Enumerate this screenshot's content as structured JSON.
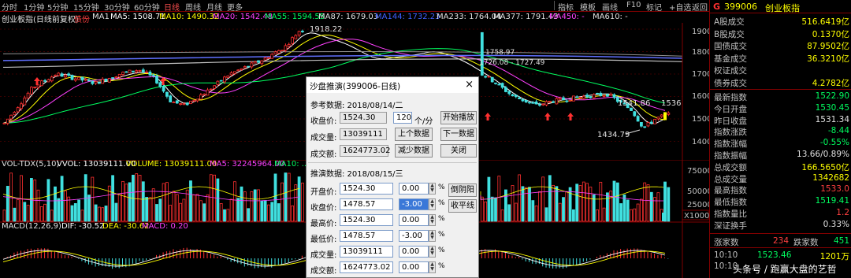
{
  "toolbar": {
    "periods": [
      "分时",
      "1分钟",
      "5分钟",
      "15分钟",
      "30分钟",
      "60分钟",
      "日线",
      "周线",
      "月线",
      "更多"
    ],
    "active_period": "日线",
    "tools": [
      "指标",
      "模板",
      "画线",
      "F10",
      "标记",
      "+自选",
      "返回"
    ]
  },
  "main_info": {
    "title": "创业板指(日线前复权)",
    "badge": "债份",
    "ma1": "MA1",
    "ma5": "MA5: 1508.71",
    "ma10": "MA10: 1490.32",
    "ma20": "MA20: 1542.48",
    "ma55": "MA55: 1594.55",
    "ma87": "MA87: 1679.03",
    "ma144": "MA144: 1732.23",
    "ma233": "MA233: 1764.04",
    "ma377": "MA377: 1791.43",
    "ma450": "MA450: -",
    "ma610": "MA610: -"
  },
  "main_chart": {
    "y_ticks": [
      "1900",
      "1800",
      "1700",
      "1600",
      "1500",
      "1400"
    ],
    "annotations": {
      "high": "1918.22",
      "label_mid1": "1758.97",
      "label_mid2": "1726.08 - 1727.49",
      "label_right": "1541.86",
      "label_right2": "1536",
      "low": "1434.79"
    }
  },
  "volume_info": {
    "title": "VOL-TDX(5,10)",
    "vvol": "VVOL: 13039111.00",
    "volume": "VOLUME: 13039111.00",
    "ma5": "MA5: 32245964.00",
    "ma10": "MA10: ..."
  },
  "volume_chart": {
    "y_ticks": [
      "75000",
      "50000",
      "25000"
    ],
    "unit": "X1000"
  },
  "macd_info": {
    "title": "MACD(12,26,9)",
    "dif": "DIF: -30.52",
    "dea": "DEA: -30.62",
    "macd": "MACD: 0.20"
  },
  "quote": {
    "g": "G",
    "code": "399006",
    "name": "创业板指",
    "rows1": [
      {
        "label": "A股成交",
        "value": "516.6419亿",
        "color": "#ffff00"
      },
      {
        "label": "B股成交",
        "value": "0.1370亿",
        "color": "#ffff00"
      },
      {
        "label": "国债成交",
        "value": "87.9502亿",
        "color": "#ffff00"
      },
      {
        "label": "基金成交",
        "value": "36.3210亿",
        "color": "#ffff00"
      },
      {
        "label": "权证成交",
        "value": "",
        "color": "#ffff00"
      },
      {
        "label": "债券成交",
        "value": "4.2782亿",
        "color": "#ffff00"
      }
    ],
    "rows2": [
      {
        "label": "最新指数",
        "value": "1522.90",
        "color": "#00ff60"
      },
      {
        "label": "今日开盘",
        "value": "1530.45",
        "color": "#00ff60"
      },
      {
        "label": "昨日收盘",
        "value": "1531.34",
        "color": "#e0e0e0"
      },
      {
        "label": "指数涨跌",
        "value": "-8.44",
        "color": "#00ff60"
      },
      {
        "label": "指数涨幅",
        "value": "-0.55%",
        "color": "#00ff60"
      },
      {
        "label": "指数振幅",
        "value": "13.66/0.89%",
        "color": "#e0e0e0"
      },
      {
        "label": "总成交额",
        "value": "166.5650亿",
        "color": "#ffff00"
      },
      {
        "label": "总成交量",
        "value": "1342682",
        "color": "#ffff00"
      },
      {
        "label": "最高指数",
        "value": "1533.0",
        "color": "#ff4040"
      },
      {
        "label": "最低指数",
        "value": "1519.41",
        "color": "#00ff60"
      },
      {
        "label": "指数量比",
        "value": "1.2",
        "color": "#ff4040"
      },
      {
        "label": "深证换手",
        "value": "0.33%",
        "color": "#e0e0e0"
      }
    ],
    "updown": {
      "up_label": "涨家数",
      "up_value": "234",
      "down_label": "跌家数",
      "down_value": "451"
    },
    "ticks": [
      {
        "time": "10:10",
        "price": "1523.46",
        "vol": "1201万"
      },
      {
        "time": "10:10",
        "price": "",
        "vol": ""
      }
    ]
  },
  "dialog": {
    "title": "沙盘推演(399006-日线)",
    "close": "×",
    "ref_label": "参考数据: 2018/08/14/二",
    "ref_rows": [
      {
        "label": "收盘价:",
        "value": "1524.30"
      },
      {
        "label": "成交量:",
        "value": "13039111"
      },
      {
        "label": "成交额:",
        "value": "1624773.02"
      }
    ],
    "speed_value": "120",
    "speed_unit": "个/分",
    "btn_start": "开始播放",
    "btn_prev": "上个数据",
    "btn_next": "下一数据",
    "btn_reduce": "减少数据",
    "btn_close": "关闭",
    "push_label": "推演数据: 2018/08/15/三",
    "push_rows": [
      {
        "label": "开盘价:",
        "value": "1524.30",
        "pct": "0.00",
        "selected": false
      },
      {
        "label": "收盘价:",
        "value": "1478.57",
        "pct": "-3.00",
        "selected": true
      },
      {
        "label": "最高价:",
        "value": "1524.30",
        "pct": "0.00",
        "selected": false
      },
      {
        "label": "最低价:",
        "value": "1478.57",
        "pct": "-3.00",
        "selected": false
      },
      {
        "label": "成交量:",
        "value": "13039111",
        "pct": "0.00",
        "selected": false
      },
      {
        "label": "成交额:",
        "value": "1624773.02",
        "pct": "0.00",
        "selected": false
      }
    ],
    "pct_sign": "%",
    "btn_yinyang": "倒阴阳",
    "btn_flat": "收平线"
  },
  "watermark": "头条号 / 跑赢大盘的艺哲"
}
